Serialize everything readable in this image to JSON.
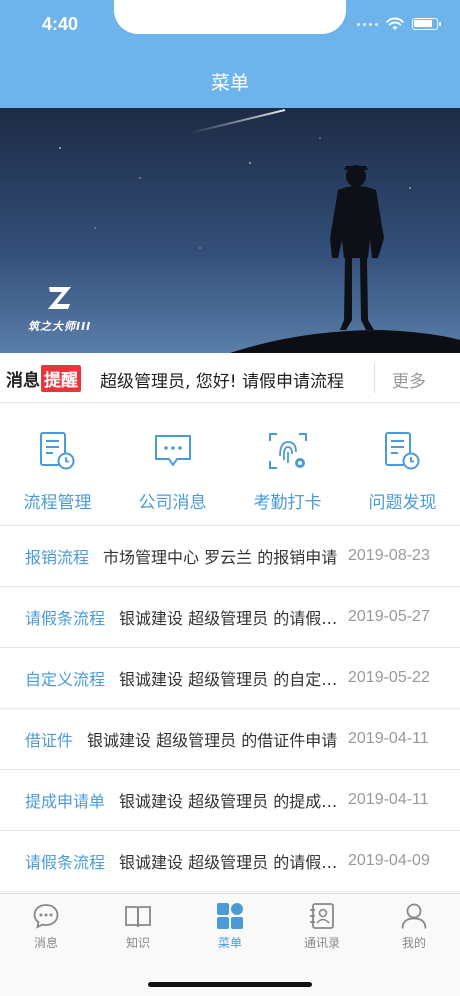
{
  "status_bar": {
    "time": "4:40"
  },
  "header": {
    "title": "菜单"
  },
  "banner": {
    "logo_text": "筑之大师III"
  },
  "notice": {
    "label_part1": "消息",
    "label_part2": "提醒",
    "text": "超级管理员, 您好! 请假申请流程",
    "more": "更多"
  },
  "quick_actions": [
    {
      "label": "流程管理",
      "icon": "document-clock-icon"
    },
    {
      "label": "公司消息",
      "icon": "chat-bubble-icon"
    },
    {
      "label": "考勤打卡",
      "icon": "fingerprint-icon"
    },
    {
      "label": "问题发现",
      "icon": "document-clock-icon"
    }
  ],
  "list": [
    {
      "category": "报销流程",
      "description": "市场管理中心 罗云兰 的报销申请",
      "date": "2019-08-23"
    },
    {
      "category": "请假条流程",
      "description": "银诚建设 超级管理员 的请假申请",
      "date": "2019-05-27"
    },
    {
      "category": "自定义流程",
      "description": "银诚建设 超级管理员 的自定义流程",
      "date": "2019-05-22"
    },
    {
      "category": "借证件",
      "description": "银诚建设 超级管理员 的借证件申请",
      "date": "2019-04-11"
    },
    {
      "category": "提成申请单",
      "description": "银诚建设 超级管理员 的提成申请",
      "date": "2019-04-11"
    },
    {
      "category": "请假条流程",
      "description": "银诚建设 超级管理员 的请假申请",
      "date": "2019-04-09"
    }
  ],
  "tabs": [
    {
      "label": "消息",
      "icon": "chat-icon",
      "active": false
    },
    {
      "label": "知识",
      "icon": "book-icon",
      "active": false
    },
    {
      "label": "菜单",
      "icon": "grid-icon",
      "active": true
    },
    {
      "label": "通讯录",
      "icon": "contacts-icon",
      "active": false
    },
    {
      "label": "我的",
      "icon": "person-icon",
      "active": false
    }
  ],
  "colors": {
    "primary": "#6db4ec",
    "accent_text": "#4a9bd8",
    "badge_red": "#e8353d"
  }
}
